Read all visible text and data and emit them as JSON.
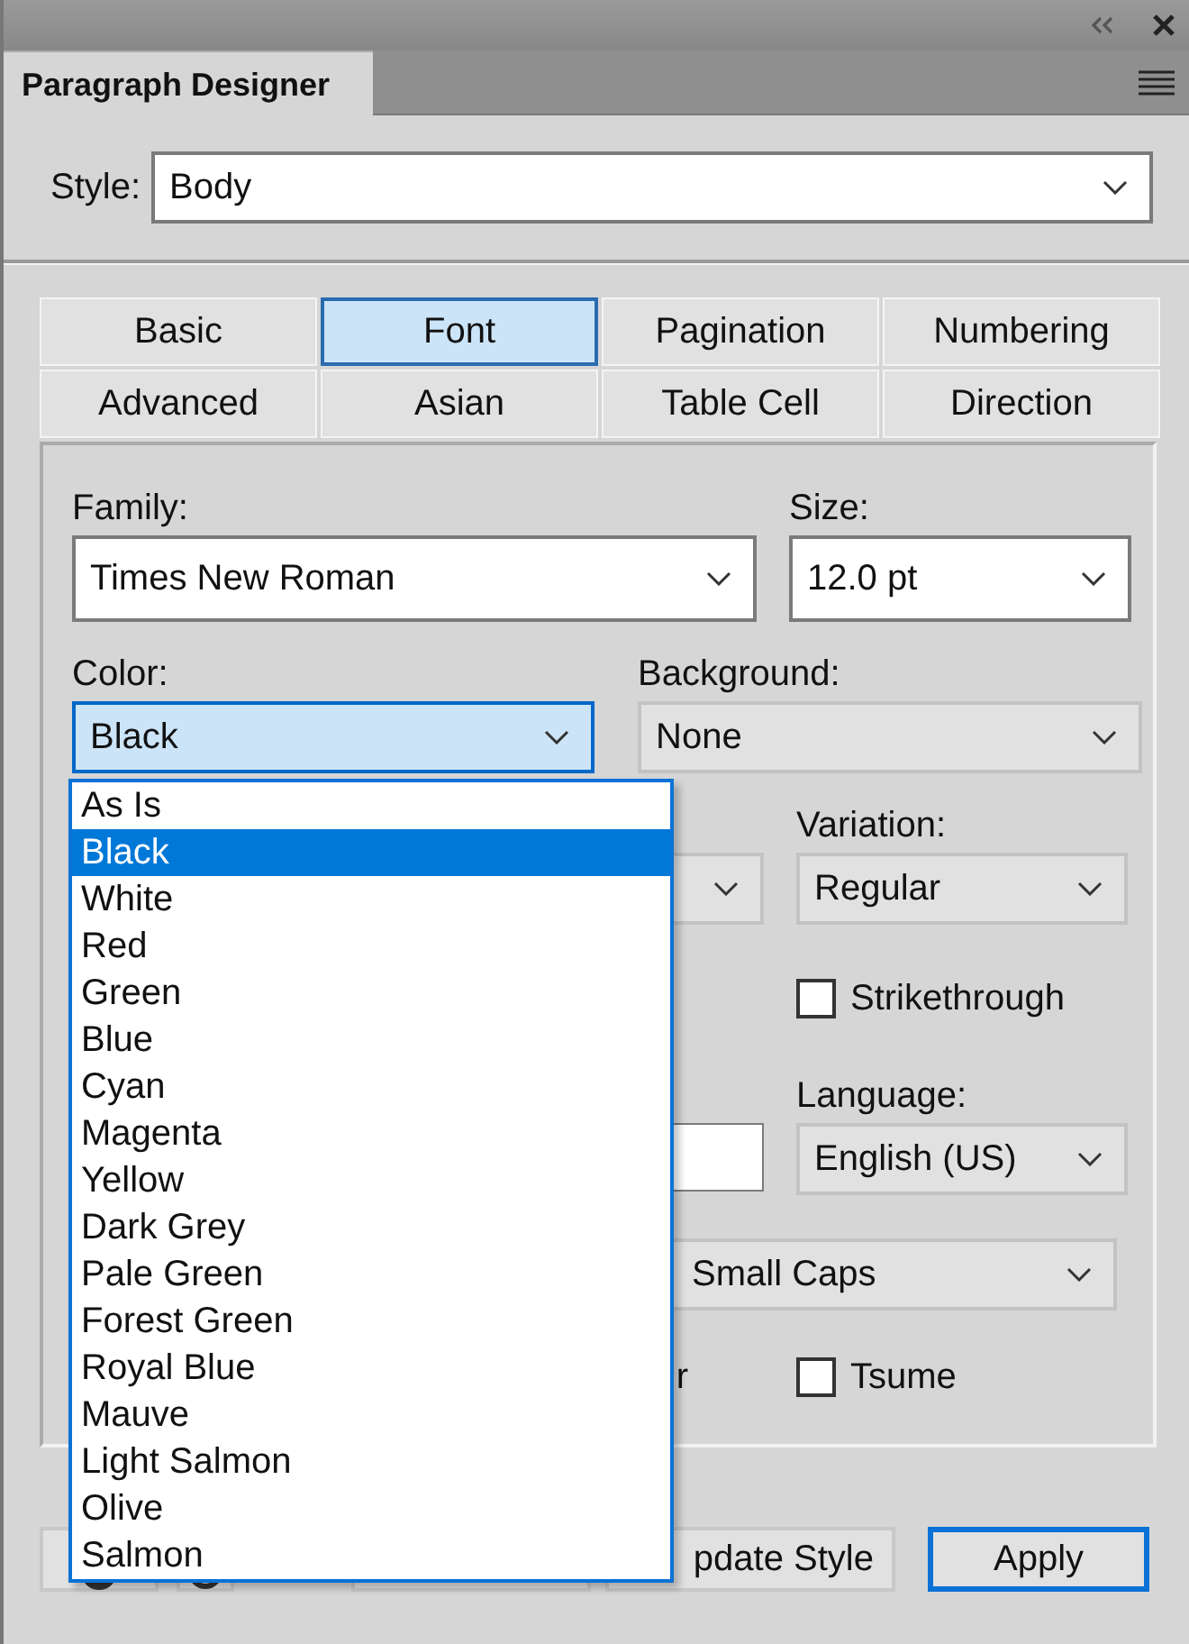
{
  "panel": {
    "title": "Paragraph Designer"
  },
  "style": {
    "label": "Style:",
    "value": "Body"
  },
  "tabs": [
    {
      "label": "Basic",
      "selected": false
    },
    {
      "label": "Font",
      "selected": true
    },
    {
      "label": "Pagination",
      "selected": false
    },
    {
      "label": "Numbering",
      "selected": false
    },
    {
      "label": "Advanced",
      "selected": false
    },
    {
      "label": "Asian",
      "selected": false
    },
    {
      "label": "Table Cell",
      "selected": false
    },
    {
      "label": "Direction",
      "selected": false
    }
  ],
  "font": {
    "family": {
      "label": "Family:",
      "value": "Times New Roman"
    },
    "size": {
      "label": "Size:",
      "value": "12.0 pt"
    },
    "color": {
      "label": "Color:",
      "value": "Black",
      "focused": true
    },
    "background": {
      "label": "Background:",
      "value": "None"
    },
    "variation": {
      "label": "Variation:",
      "value": "Regular"
    },
    "strikethrough": {
      "label": "Strikethrough",
      "checked": false
    },
    "language": {
      "label": "Language:",
      "value": "English (US)"
    },
    "case": {
      "value": "Small Caps"
    },
    "partial_label": "r",
    "tsume": {
      "label": "Tsume",
      "checked": false
    }
  },
  "color_list": [
    {
      "label": "As Is",
      "selected": false
    },
    {
      "label": "Black",
      "selected": true
    },
    {
      "label": "White",
      "selected": false
    },
    {
      "label": "Red",
      "selected": false
    },
    {
      "label": "Green",
      "selected": false
    },
    {
      "label": "Blue",
      "selected": false
    },
    {
      "label": "Cyan",
      "selected": false
    },
    {
      "label": "Magenta",
      "selected": false
    },
    {
      "label": "Yellow",
      "selected": false
    },
    {
      "label": "Dark Grey",
      "selected": false
    },
    {
      "label": "Pale Green",
      "selected": false
    },
    {
      "label": "Forest Green",
      "selected": false
    },
    {
      "label": "Royal Blue",
      "selected": false
    },
    {
      "label": "Mauve",
      "selected": false
    },
    {
      "label": "Light Salmon",
      "selected": false
    },
    {
      "label": "Olive",
      "selected": false
    },
    {
      "label": "Salmon",
      "selected": false
    }
  ],
  "buttons": [
    {
      "label": "pdate Style",
      "kind": "normal"
    },
    {
      "label": "Apply",
      "kind": "default"
    }
  ]
}
